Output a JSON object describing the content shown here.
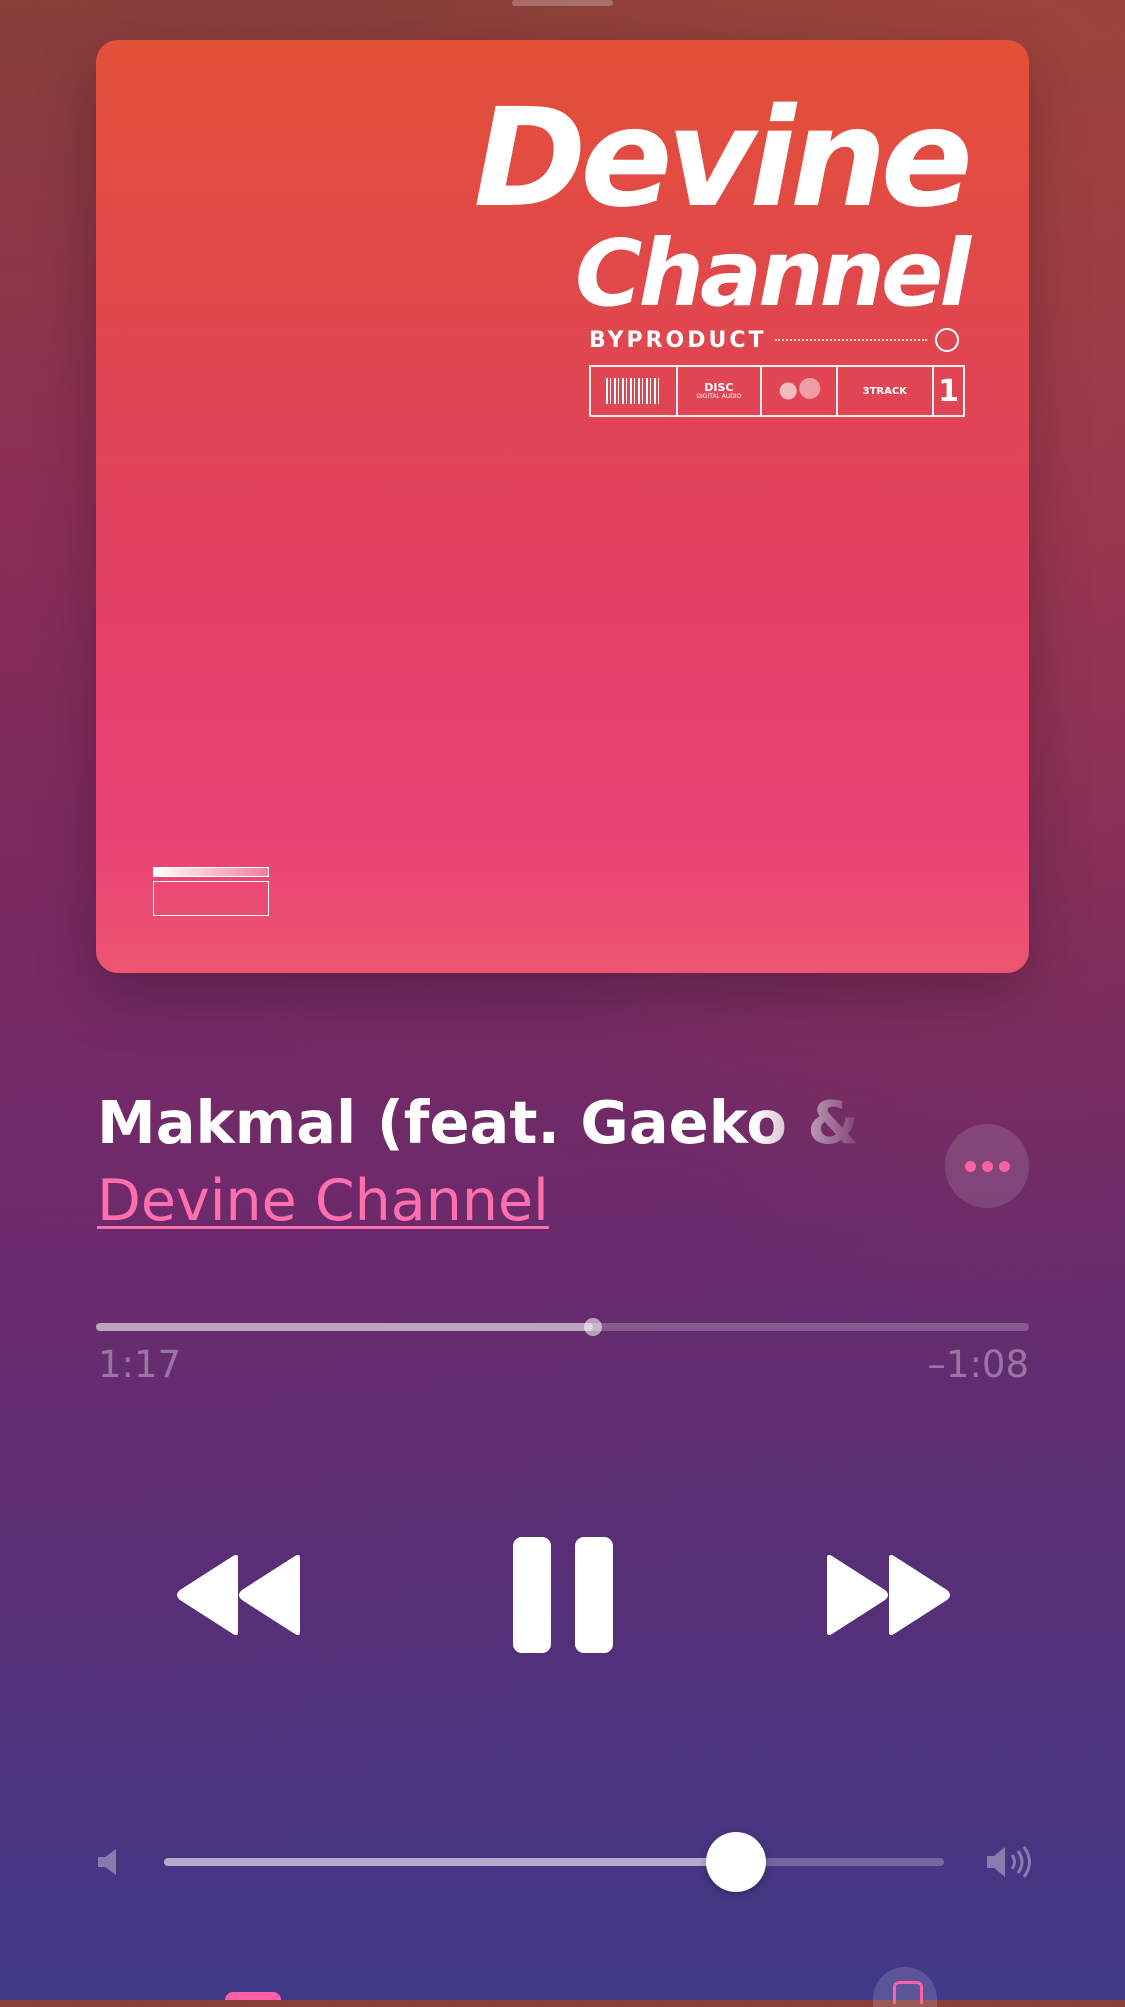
{
  "artwork": {
    "title_line1": "Devine",
    "title_line2": "Channel",
    "label": "BYPRODUCT",
    "disc_label": "DISC",
    "disc_sub": "DIGITAL AUDIO",
    "track_count_label": "3TRACK",
    "single_number": "1"
  },
  "now_playing": {
    "title": "Makmal (feat. Gaeko & Gwangil Jo)",
    "artist": "Devine Channel"
  },
  "progress": {
    "elapsed": "1:17",
    "remaining": "–1:08",
    "fraction": 0.533
  },
  "volume": {
    "fraction": 0.733
  },
  "colors": {
    "accent": "#ff5fa6",
    "artwork_top": "#e35038",
    "artwork_bottom": "#ec5570"
  },
  "icons": {
    "rewind": "rewind-icon",
    "pause": "pause-icon",
    "forward": "fast-forward-icon",
    "more": "ellipsis-icon",
    "volume_min": "speaker-low-icon",
    "volume_max": "speaker-high-icon",
    "lyrics": "lyrics-icon",
    "repeat": "repeat-icon"
  }
}
